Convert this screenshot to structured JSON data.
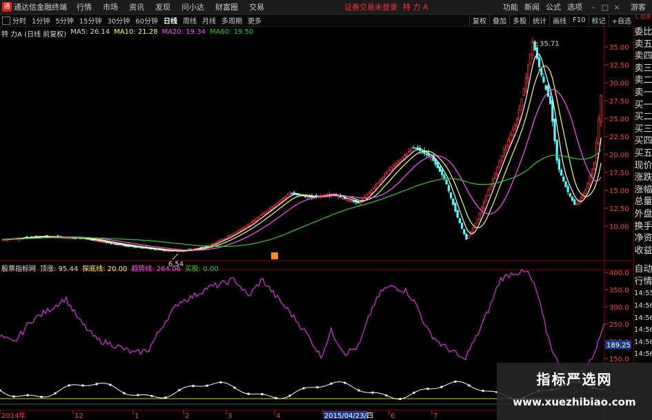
{
  "menubar": {
    "app_title": "通达信金融终端",
    "items": [
      "行情",
      "市场",
      "资讯",
      "发现",
      "问小达",
      "财富圈",
      "交易"
    ],
    "notice": "证券交易未登录",
    "stock": "特 力 A",
    "right_items": [
      "功能",
      "新闻",
      "公式",
      "选项"
    ],
    "user": "游客"
  },
  "toolbar": {
    "periods": [
      "分时",
      "1分钟",
      "5分钟",
      "15分钟",
      "30分钟",
      "60分钟",
      "日线",
      "周线",
      "月线",
      "多周期",
      "更多"
    ],
    "active_period": "日线",
    "right_buttons": [
      "复权",
      "叠加",
      "多股",
      "统计",
      "画线",
      "F10",
      "标记",
      "+自选"
    ],
    "corner": "L 信息"
  },
  "price_header": {
    "title": "特 力A (日线 前复权)",
    "ma5": "MA5: 26.14",
    "ma10": "MA10: 21.28",
    "ma20": "MA20: 19.34",
    "ma60": "MA60: 19.50"
  },
  "price_axis": [
    "35.00",
    "32.50",
    "30.00",
    "27.50",
    "25.00",
    "22.50",
    "20.00",
    "17.50",
    "15.00",
    "12.50",
    "10.00"
  ],
  "annotations": {
    "high": "35.71",
    "low": "6.54"
  },
  "osc_header": {
    "name": "股票指标网",
    "v1": "顶涨: 95.44",
    "v2": "探底线: 20.00",
    "v3": "趋势线: 264.06",
    "v4": "买股: 0.00"
  },
  "osc_axis": [
    "400.0",
    "350.0",
    "300.0",
    "250.0",
    "200.0",
    "150.0"
  ],
  "osc_value_badge": "189.25",
  "time_axis": [
    "2014年",
    "12",
    "1",
    "2",
    "3",
    "4",
    "2015/04/23/四",
    "6",
    "7"
  ],
  "side_panel": [
    "委比",
    "卖五",
    "卖四",
    "卖三",
    "卖二",
    "卖一",
    "买一",
    "买二",
    "买三",
    "买四",
    "买五",
    "现价",
    "涨跌",
    "涨幅",
    "总量",
    "外盘",
    "换手",
    "净资",
    "收益"
  ],
  "side_panel_lower": [
    "自动",
    "行情",
    "14:55",
    "14:56",
    "14:56",
    "14:56",
    "14:56",
    "14:56"
  ],
  "watermark": {
    "title": "指标严选网",
    "url": "www.xuezhibiao.com"
  },
  "colors": {
    "up": "#ff3333",
    "down": "#54ffff",
    "ma5": "#ffffff",
    "ma10": "#ffff66",
    "ma20": "#ff55ff",
    "ma60": "#33cc33",
    "osc_main": "#cc33cc"
  }
}
